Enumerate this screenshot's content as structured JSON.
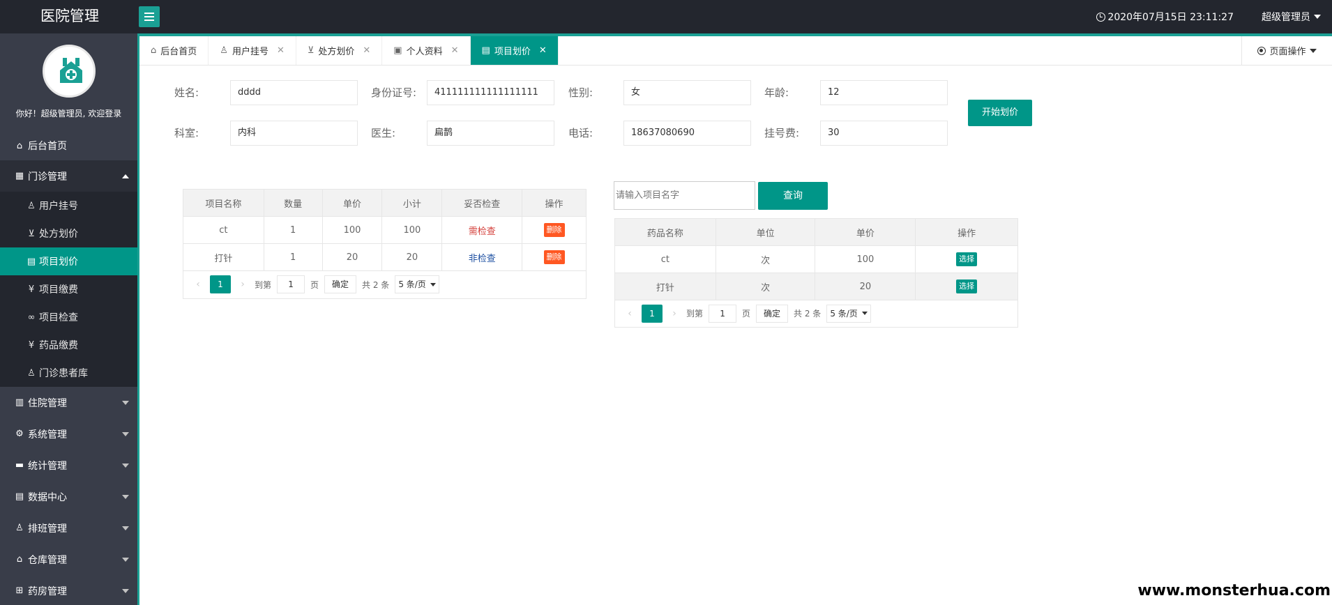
{
  "header": {
    "title": "医院管理",
    "datetime": "2020年07月15日 23:11:27",
    "user": "超级管理员"
  },
  "sidebar": {
    "welcome": "你好！超级管理员, 欢迎登录",
    "home": "后台首页",
    "outpatient": {
      "label": "门诊管理",
      "children": [
        "用户挂号",
        "处方划价",
        "项目划价",
        "项目缴费",
        "项目检查",
        "药品缴费",
        "门诊患者库"
      ]
    },
    "groups": [
      "住院管理",
      "系统管理",
      "统计管理",
      "数据中心",
      "排班管理",
      "仓库管理",
      "药房管理"
    ]
  },
  "tabs": [
    "后台首页",
    "用户挂号",
    "处方划价",
    "个人资料",
    "项目划价"
  ],
  "page_ops": "页面操作",
  "form": {
    "name_label": "姓名:",
    "name_value": "dddd",
    "id_label": "身份证号:",
    "id_value": "411111111111111111",
    "gender_label": "性别:",
    "gender_value": "女",
    "age_label": "年龄:",
    "age_value": "12",
    "dept_label": "科室:",
    "dept_value": "内科",
    "doctor_label": "医生:",
    "doctor_value": "扁鹊",
    "phone_label": "电话:",
    "phone_value": "18637080690",
    "fee_label": "挂号费:",
    "fee_value": "30",
    "start_button": "开始划价"
  },
  "left_table": {
    "headers": [
      "项目名称",
      "数量",
      "单价",
      "小计",
      "妥否检查",
      "操作"
    ],
    "rows": [
      {
        "name": "ct",
        "qty": "1",
        "price": "100",
        "subtotal": "100",
        "check": "需检查",
        "action": "删除"
      },
      {
        "name": "打针",
        "qty": "1",
        "price": "20",
        "subtotal": "20",
        "check": "非检查",
        "action": "删除"
      }
    ]
  },
  "right_table": {
    "search_placeholder": "请输入项目名字",
    "search_button": "查询",
    "headers": [
      "药品名称",
      "单位",
      "单价",
      "操作"
    ],
    "rows": [
      {
        "name": "ct",
        "unit": "次",
        "price": "100",
        "action": "选择"
      },
      {
        "name": "打针",
        "unit": "次",
        "price": "20",
        "action": "选择"
      }
    ]
  },
  "pager": {
    "prev": "‹",
    "next": "›",
    "current": "1",
    "goto_label": "到第",
    "goto_value": "1",
    "page_unit": "页",
    "confirm": "确定",
    "total": "共 2 条",
    "per_page": "5 条/页"
  },
  "watermark": "www.monsterhua.com"
}
